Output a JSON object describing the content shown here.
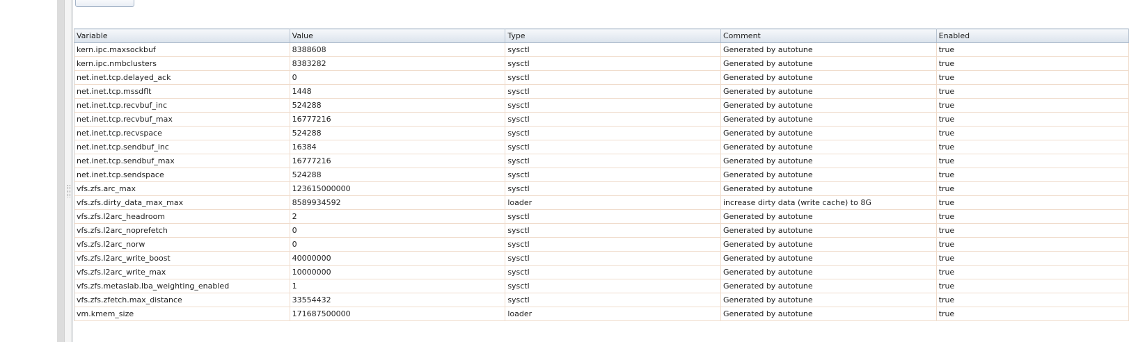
{
  "columns": {
    "variable": "Variable",
    "value": "Value",
    "type": "Type",
    "comment": "Comment",
    "enabled": "Enabled"
  },
  "rows": [
    {
      "variable": "kern.ipc.maxsockbuf",
      "value": "8388608",
      "type": "sysctl",
      "comment": "Generated by autotune",
      "enabled": "true"
    },
    {
      "variable": "kern.ipc.nmbclusters",
      "value": "8383282",
      "type": "sysctl",
      "comment": "Generated by autotune",
      "enabled": "true"
    },
    {
      "variable": "net.inet.tcp.delayed_ack",
      "value": "0",
      "type": "sysctl",
      "comment": "Generated by autotune",
      "enabled": "true"
    },
    {
      "variable": "net.inet.tcp.mssdflt",
      "value": "1448",
      "type": "sysctl",
      "comment": "Generated by autotune",
      "enabled": "true"
    },
    {
      "variable": "net.inet.tcp.recvbuf_inc",
      "value": "524288",
      "type": "sysctl",
      "comment": "Generated by autotune",
      "enabled": "true"
    },
    {
      "variable": "net.inet.tcp.recvbuf_max",
      "value": "16777216",
      "type": "sysctl",
      "comment": "Generated by autotune",
      "enabled": "true"
    },
    {
      "variable": "net.inet.tcp.recvspace",
      "value": "524288",
      "type": "sysctl",
      "comment": "Generated by autotune",
      "enabled": "true"
    },
    {
      "variable": "net.inet.tcp.sendbuf_inc",
      "value": "16384",
      "type": "sysctl",
      "comment": "Generated by autotune",
      "enabled": "true"
    },
    {
      "variable": "net.inet.tcp.sendbuf_max",
      "value": "16777216",
      "type": "sysctl",
      "comment": "Generated by autotune",
      "enabled": "true"
    },
    {
      "variable": "net.inet.tcp.sendspace",
      "value": "524288",
      "type": "sysctl",
      "comment": "Generated by autotune",
      "enabled": "true"
    },
    {
      "variable": "vfs.zfs.arc_max",
      "value": "123615000000",
      "type": "sysctl",
      "comment": "Generated by autotune",
      "enabled": "true"
    },
    {
      "variable": "vfs.zfs.dirty_data_max_max",
      "value": "8589934592",
      "type": "loader",
      "comment": "increase dirty data (write cache) to 8G",
      "enabled": "true"
    },
    {
      "variable": "vfs.zfs.l2arc_headroom",
      "value": "2",
      "type": "sysctl",
      "comment": "Generated by autotune",
      "enabled": "true"
    },
    {
      "variable": "vfs.zfs.l2arc_noprefetch",
      "value": "0",
      "type": "sysctl",
      "comment": "Generated by autotune",
      "enabled": "true"
    },
    {
      "variable": "vfs.zfs.l2arc_norw",
      "value": "0",
      "type": "sysctl",
      "comment": "Generated by autotune",
      "enabled": "true"
    },
    {
      "variable": "vfs.zfs.l2arc_write_boost",
      "value": "40000000",
      "type": "sysctl",
      "comment": "Generated by autotune",
      "enabled": "true"
    },
    {
      "variable": "vfs.zfs.l2arc_write_max",
      "value": "10000000",
      "type": "sysctl",
      "comment": "Generated by autotune",
      "enabled": "true"
    },
    {
      "variable": "vfs.zfs.metaslab.lba_weighting_enabled",
      "value": "1",
      "type": "sysctl",
      "comment": "Generated by autotune",
      "enabled": "true"
    },
    {
      "variable": "vfs.zfs.zfetch.max_distance",
      "value": "33554432",
      "type": "sysctl",
      "comment": "Generated by autotune",
      "enabled": "true"
    },
    {
      "variable": "vm.kmem_size",
      "value": "171687500000",
      "type": "loader",
      "comment": "Generated by autotune",
      "enabled": "true"
    }
  ]
}
